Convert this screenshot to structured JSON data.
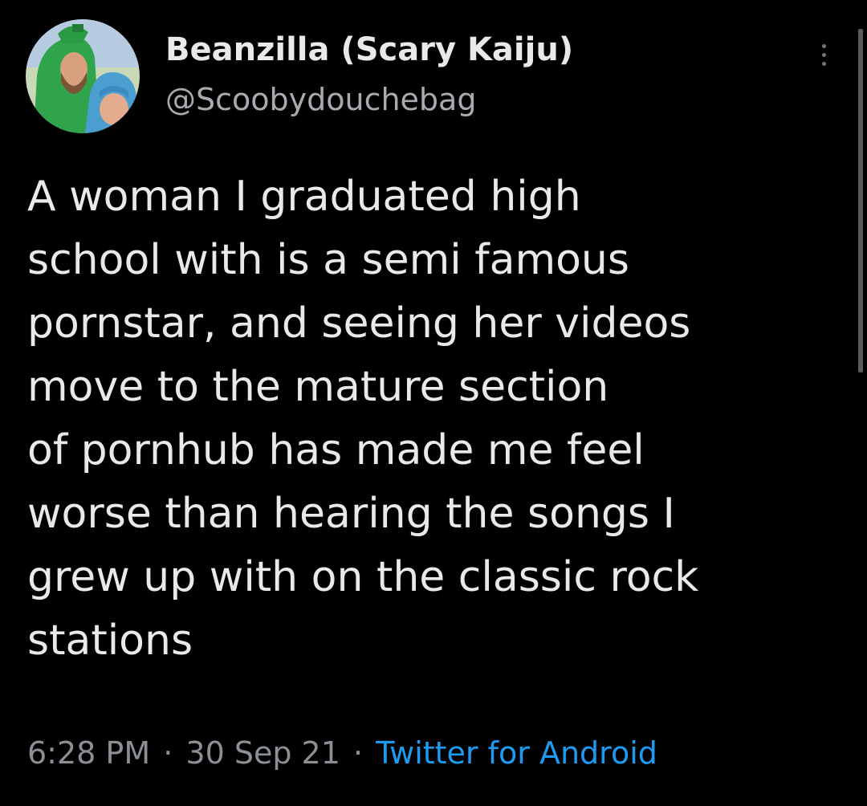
{
  "tweet": {
    "author": {
      "display_name": "Beanzilla (Scary Kaiju)",
      "handle": "@Scoobydouchebag",
      "avatar_icon": "profile-photo-avatar"
    },
    "more_icon": "more-options-icon",
    "text": "A woman I graduated high\nschool with is a semi famous\npornstar, and seeing her videos\nmove to the mature section\nof pornhub has made me feel\nworse than hearing the songs I\ngrew up with on the classic rock\nstations",
    "time": "6:28 PM",
    "date": "30 Sep 21",
    "separator": "·",
    "source": "Twitter for Android"
  },
  "colors": {
    "background": "#000000",
    "primary_text": "#e7e9ea",
    "secondary_text": "#8b9096",
    "link": "#1d9bf0"
  }
}
